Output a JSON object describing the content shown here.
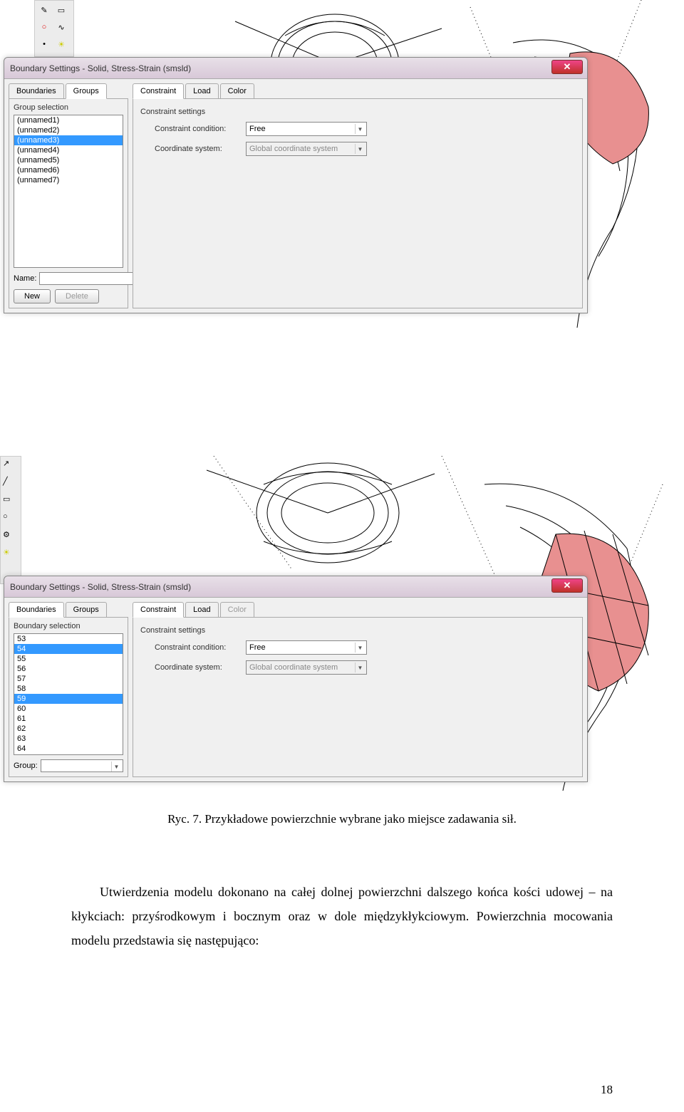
{
  "toolbar_icons": [
    "pencil",
    "rect",
    "circle",
    "curve",
    "point",
    "zoom",
    "lock",
    "sun",
    "axis",
    "delete"
  ],
  "dialog1": {
    "title": "Boundary Settings - Solid, Stress-Strain (smsld)",
    "left_tabs": [
      "Boundaries",
      "Groups"
    ],
    "left_active_tab": 1,
    "group_selection_label": "Group selection",
    "list_items": [
      "(unnamed1)",
      "(unnamed2)",
      "(unnamed3)",
      "(unnamed4)",
      "(unnamed5)",
      "(unnamed6)",
      "(unnamed7)"
    ],
    "selected_index": 2,
    "name_label": "Name:",
    "name_value": "",
    "btn_new": "New",
    "btn_delete": "Delete",
    "right_tabs": [
      "Constraint",
      "Load",
      "Color"
    ],
    "right_active_tab": 0,
    "settings_label": "Constraint settings",
    "constraint_condition_label": "Constraint condition:",
    "constraint_condition_value": "Free",
    "coord_system_label": "Coordinate system:",
    "coord_system_value": "Global coordinate system"
  },
  "dialog2": {
    "title": "Boundary Settings - Solid, Stress-Strain (smsld)",
    "left_tabs": [
      "Boundaries",
      "Groups"
    ],
    "left_active_tab": 0,
    "boundary_selection_label": "Boundary selection",
    "list_items": [
      "53",
      "54",
      "55",
      "56",
      "57",
      "58",
      "59",
      "60",
      "61",
      "62",
      "63",
      "64"
    ],
    "selected_indices": [
      1,
      6
    ],
    "group_label": "Group:",
    "group_value": "",
    "right_tabs": [
      "Constraint",
      "Load",
      "Color"
    ],
    "right_active_tab": 0,
    "settings_label": "Constraint settings",
    "constraint_condition_label": "Constraint condition:",
    "constraint_condition_value": "Free",
    "coord_system_label": "Coordinate system:",
    "coord_system_value": "Global coordinate system"
  },
  "caption_text": "Ryc. 7. Przykładowe powierzchnie wybrane jako miejsce zadawania sił.",
  "body_text": "Utwierdzenia modelu dokonano na całej dolnej powierzchni dalszego końca kości udowej – na kłykciach: przyśrodkowym i bocznym oraz w dole międzykłykciowym. Powierzchnia mocowania modelu przedstawia się następująco:",
  "page_number": "18"
}
